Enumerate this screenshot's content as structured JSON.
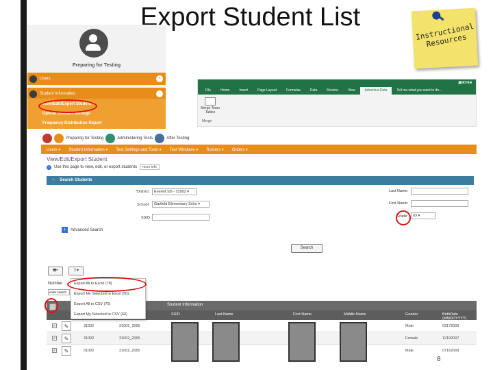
{
  "title": "Export Student List",
  "sticky_note": {
    "line1": "Instructional",
    "line2": "Resources"
  },
  "left_menu": {
    "heading": "Preparing for Testing",
    "sections": [
      {
        "label": "Users",
        "chevron": "+"
      },
      {
        "label": "Student Information",
        "chevron": "-"
      }
    ],
    "subitems": [
      "View/Edit/Export Student",
      "Upload Student Settings",
      "Frequency Distribution Report"
    ]
  },
  "excel": {
    "file_name": "2015-16",
    "tabs": [
      "File",
      "Home",
      "Insert",
      "Page Layout",
      "Formulas",
      "Data",
      "Review",
      "View",
      "Adventus Data"
    ],
    "active_tab": "Adventus Data",
    "tell_me": "Tell me what you want to do...",
    "merge_label": "Merge Team Tables",
    "group_label": "Merge"
  },
  "app": {
    "crumbs": [
      "Preparing for Testing",
      "Administering Tests",
      "After Testing"
    ],
    "nav": [
      "Users ▾",
      "Student Information ▾",
      "Test Settings and Tools ▾",
      "Test Windows ▾",
      "Rosters ▾",
      "Orders ▾"
    ],
    "page_title": "View/Edit/Export Student",
    "info_text": "Use this page to view, edit, or export students",
    "more_info": "more info",
    "search_panel": "Search Students",
    "fields": {
      "district_label": "*District:",
      "district_value": "Everett SD - 31002",
      "school_label": "School:",
      "school_value": "Garfield Elementary Scho",
      "ssid_label": "SSID:",
      "lastname_label": "Last Name:",
      "firstname_label": "First Name:",
      "grade_label": "Grade:",
      "grade_value": "03"
    },
    "advanced_search": "Advanced Search",
    "search_button": "Search",
    "export_menu": [
      "Export All to Excel (78)",
      "Export My Selected to Excel (50)",
      "Export All to CSV (75)",
      "Export My Selected to CSV (60)"
    ],
    "number_label": "Number",
    "number_input": "enter search",
    "table": {
      "group_header": "Student Information",
      "columns": [
        "SSID",
        "Last Name",
        "First Name",
        "Middle Name",
        "Gender",
        "BirthDate (MMDDYYYY)"
      ],
      "rows": [
        {
          "district": "31002",
          "school": "31002_2065",
          "gender": "Male",
          "birth": "03172009"
        },
        {
          "district": "31002",
          "school": "31002_2065",
          "gender": "Female",
          "birth": "12192007"
        },
        {
          "district": "31002",
          "school": "31002_2065",
          "gender": "Male",
          "birth": "07162009"
        }
      ]
    }
  },
  "page_number": "8",
  "colors": {
    "accent_orange": "#e78d1a",
    "panel_blue": "#3c7c9e",
    "highlight_red": "#e01010",
    "excel_green": "#217346"
  }
}
